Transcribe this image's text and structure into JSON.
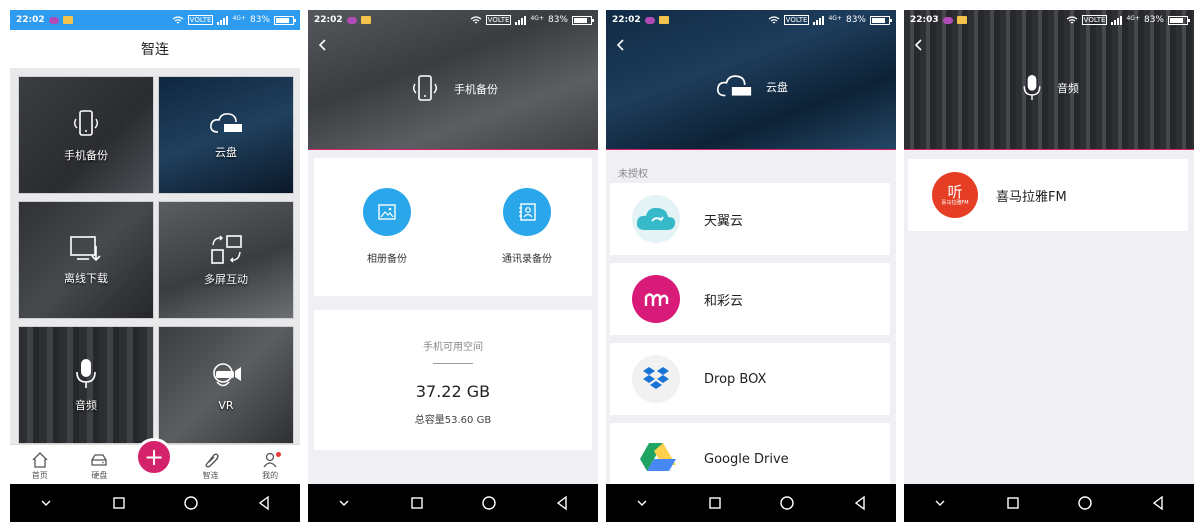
{
  "status": {
    "time_a": "22:02",
    "time_b": "22:03",
    "volte": "VOLTE",
    "net": "4G+",
    "battery": "83%"
  },
  "home": {
    "title": "智连",
    "tiles": [
      "手机备份",
      "云盘",
      "离线下载",
      "多屏互动",
      "音频",
      "VR"
    ],
    "tabs": [
      "首页",
      "硬盘",
      "智连",
      "我的"
    ],
    "fab": "+"
  },
  "backup": {
    "header": "手机备份",
    "photo": "相册备份",
    "contacts": "通讯录备份",
    "space_label": "手机可用空间",
    "space_value": "37.22 GB",
    "total": "总容量53.60 GB"
  },
  "cloud": {
    "header": "云盘",
    "section": "未授权",
    "providers": [
      "天翼云",
      "和彩云",
      "Drop BOX",
      "Google Drive"
    ]
  },
  "audio": {
    "header": "音频",
    "logo_text": "听",
    "logo_sub": "喜马拉雅FM",
    "item": "喜马拉雅FM"
  },
  "colors": {
    "accent": "#d4236b",
    "status_blue": "#2d9bf0",
    "button_blue": "#29a7ea"
  }
}
